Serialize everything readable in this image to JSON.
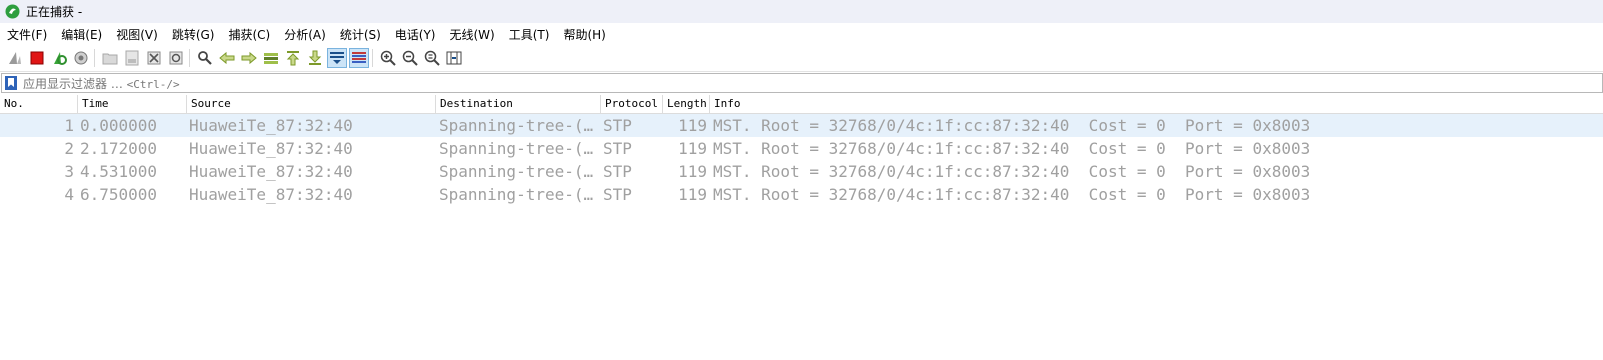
{
  "window": {
    "title": "正在捕获 -"
  },
  "menu": [
    {
      "label": "文件(F)"
    },
    {
      "label": "编辑(E)"
    },
    {
      "label": "视图(V)"
    },
    {
      "label": "跳转(G)"
    },
    {
      "label": "捕获(C)"
    },
    {
      "label": "分析(A)"
    },
    {
      "label": "统计(S)"
    },
    {
      "label": "电话(Y)"
    },
    {
      "label": "无线(W)"
    },
    {
      "label": "工具(T)"
    },
    {
      "label": "帮助(H)"
    }
  ],
  "toolbar": {
    "icons": [
      "shark-fin-start-icon",
      "stop-icon",
      "restart-capture-icon",
      "capture-options-icon",
      "open-file-icon",
      "save-file-icon",
      "close-file-icon",
      "reload-file-icon",
      "find-icon",
      "go-back-icon",
      "go-forward-icon",
      "go-to-packet-icon",
      "go-first-icon",
      "go-last-icon",
      "auto-scroll-icon",
      "colorize-icon",
      "zoom-in-icon",
      "zoom-out-icon",
      "normal-size-icon",
      "resize-columns-icon"
    ]
  },
  "filter": {
    "placeholder_text": "应用显示过滤器 …",
    "shortcut": "<Ctrl-/>"
  },
  "packet_list": {
    "columns": [
      "No.",
      "Time",
      "Source",
      "Destination",
      "Protocol",
      "Length",
      "Info"
    ],
    "rows": [
      {
        "no": "1",
        "time": "0.000000",
        "source": "HuaweiTe_87:32:40",
        "destination": "Spanning-tree-(…",
        "protocol": "STP",
        "length": "119",
        "info": "MST. Root = 32768/0/4c:1f:cc:87:32:40  Cost = 0  Port = 0x8003"
      },
      {
        "no": "2",
        "time": "2.172000",
        "source": "HuaweiTe_87:32:40",
        "destination": "Spanning-tree-(…",
        "protocol": "STP",
        "length": "119",
        "info": "MST. Root = 32768/0/4c:1f:cc:87:32:40  Cost = 0  Port = 0x8003"
      },
      {
        "no": "3",
        "time": "4.531000",
        "source": "HuaweiTe_87:32:40",
        "destination": "Spanning-tree-(…",
        "protocol": "STP",
        "length": "119",
        "info": "MST. Root = 32768/0/4c:1f:cc:87:32:40  Cost = 0  Port = 0x8003"
      },
      {
        "no": "4",
        "time": "6.750000",
        "source": "HuaweiTe_87:32:40",
        "destination": "Spanning-tree-(…",
        "protocol": "STP",
        "length": "119",
        "info": "MST. Root = 32768/0/4c:1f:cc:87:32:40  Cost = 0  Port = 0x8003"
      }
    ]
  },
  "colors": {
    "selected_row": "#e6f1fb",
    "row_text": "#a0a0a0",
    "titlebar": "#eef0f8"
  }
}
